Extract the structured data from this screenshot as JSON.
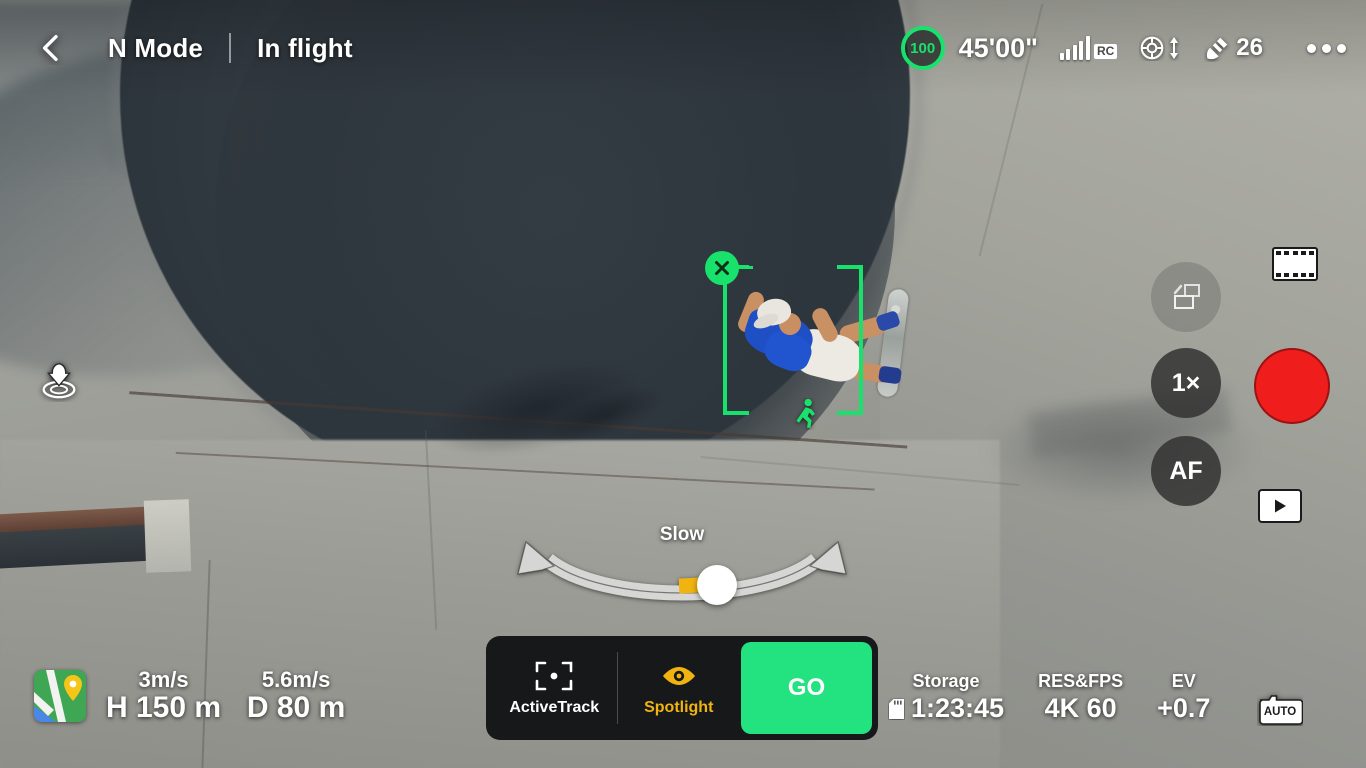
{
  "topbar": {
    "back_icon": "chevron-left-icon",
    "mode": "N Mode",
    "flight_status": "In flight",
    "battery": {
      "percent": "100",
      "ring_color": "#18e26c"
    },
    "flight_time": "45'00\"",
    "signal": {
      "icon": "signal-bars-icon",
      "bars_filled": 5,
      "label": "RC"
    },
    "obstacle_sensing": {
      "icon": "obstacle-sensing-icon",
      "direction_icon": "up-down-arrow-icon"
    },
    "satellites": {
      "icon": "satellite-icon",
      "count": "26"
    },
    "more_menu": "more-options-icon"
  },
  "overlay": {
    "rth_icon": "return-to-home-icon",
    "tracking": {
      "close_label": "×",
      "subject_icon": "running-person-icon",
      "bracket_color": "#18e26c"
    }
  },
  "orbit_slider": {
    "label": "Slow",
    "knob_position_percent": 54,
    "fill_color": "#f0b310",
    "track_color": "#d6d6d4"
  },
  "right_rail": {
    "filmstrip_icon": "filmstrip-icon",
    "pano_button": {
      "icon": "panorama-switch-icon",
      "enabled": false
    },
    "zoom_button": {
      "label": "1×"
    },
    "focus_button": {
      "label": "AF"
    },
    "record_button": {
      "icon": "record-button-icon",
      "color": "#f01d1d"
    },
    "playback_button": {
      "icon": "play-icon"
    },
    "auto_camera": {
      "icon": "camera-icon",
      "label": "AUTO"
    }
  },
  "bottom_panel": {
    "items": [
      {
        "label": "ActiveTrack",
        "icon": "bracket-dot-icon",
        "active": false
      },
      {
        "label": "Spotlight",
        "icon": "eye-icon",
        "active": true
      }
    ],
    "go_button": {
      "label": "GO",
      "color": "#22e37f"
    }
  },
  "telemetry": {
    "map_icon": "map-thumbnail-icon",
    "columns": [
      {
        "speed": "3m/s",
        "value": "H 150 m"
      },
      {
        "speed": "5.6m/s",
        "value": "D 80 m"
      }
    ]
  },
  "camera_info": [
    {
      "head": "Storage",
      "value": "1:23:45",
      "icon": "sd-card-icon"
    },
    {
      "head": "RES&FPS",
      "value": "4K 60",
      "icon": ""
    },
    {
      "head": "EV",
      "value": "+0.7",
      "icon": ""
    }
  ]
}
